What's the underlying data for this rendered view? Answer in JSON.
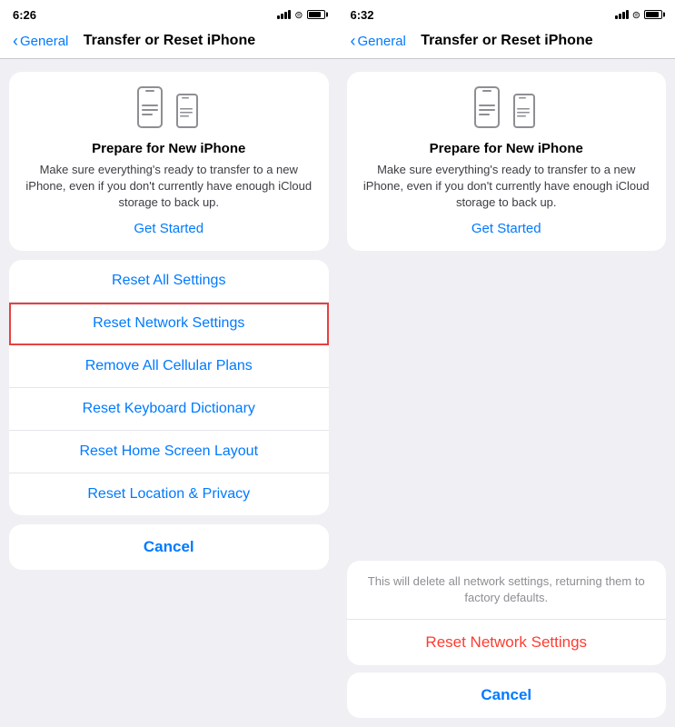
{
  "left_panel": {
    "status": {
      "time": "6:26",
      "arrow": "↗"
    },
    "nav": {
      "back_label": "General",
      "title": "Transfer or Reset iPhone"
    },
    "prepare": {
      "title": "Prepare for New iPhone",
      "description": "Make sure everything's ready to transfer to a new iPhone, even if you don't currently have enough iCloud storage to back up.",
      "link": "Get Started"
    },
    "reset_items": [
      {
        "label": "Reset All Settings"
      },
      {
        "label": "Reset Network Settings",
        "highlighted": true
      },
      {
        "label": "Remove All Cellular Plans"
      },
      {
        "label": "Reset Keyboard Dictionary"
      },
      {
        "label": "Reset Home Screen Layout"
      },
      {
        "label": "Reset Location & Privacy"
      }
    ],
    "cancel": "Cancel"
  },
  "right_panel": {
    "status": {
      "time": "6:32",
      "arrow": "↗"
    },
    "nav": {
      "back_label": "General",
      "title": "Transfer or Reset iPhone"
    },
    "prepare": {
      "title": "Prepare for New iPhone",
      "description": "Make sure everything's ready to transfer to a new iPhone, even if you don't currently have enough iCloud storage to back up.",
      "link": "Get Started"
    },
    "action_sheet": {
      "message": "This will delete all network settings, returning them to factory defaults.",
      "action": "Reset Network Settings",
      "cancel": "Cancel"
    }
  }
}
